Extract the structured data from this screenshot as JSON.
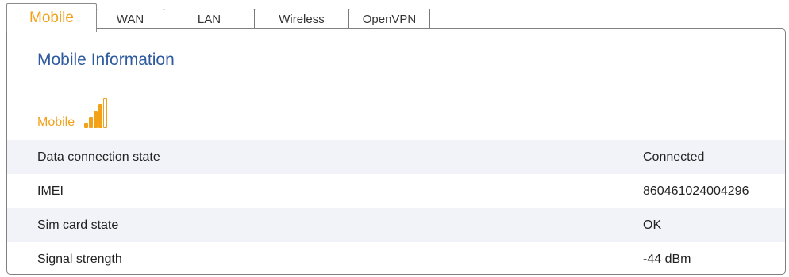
{
  "tabs": [
    {
      "label": "Mobile",
      "active": true
    },
    {
      "label": "WAN",
      "active": false
    },
    {
      "label": "LAN",
      "active": false
    },
    {
      "label": "Wireless",
      "active": false
    },
    {
      "label": "OpenVPN",
      "active": false
    }
  ],
  "section": {
    "title": "Mobile Information",
    "subheader": "Mobile",
    "signal_icon": "signal-bars-icon",
    "signal_level": 4,
    "signal_max": 5
  },
  "rows": [
    {
      "label": "Data connection state",
      "value": "Connected"
    },
    {
      "label": "IMEI",
      "value": "860461024004296"
    },
    {
      "label": "Sim card state",
      "value": "OK"
    },
    {
      "label": "Signal strength",
      "value": "-44 dBm"
    }
  ],
  "colors": {
    "accent": "#f2a118",
    "title": "#2f5aa0",
    "row_stripe": "#f2f3f8",
    "border": "#808080"
  }
}
